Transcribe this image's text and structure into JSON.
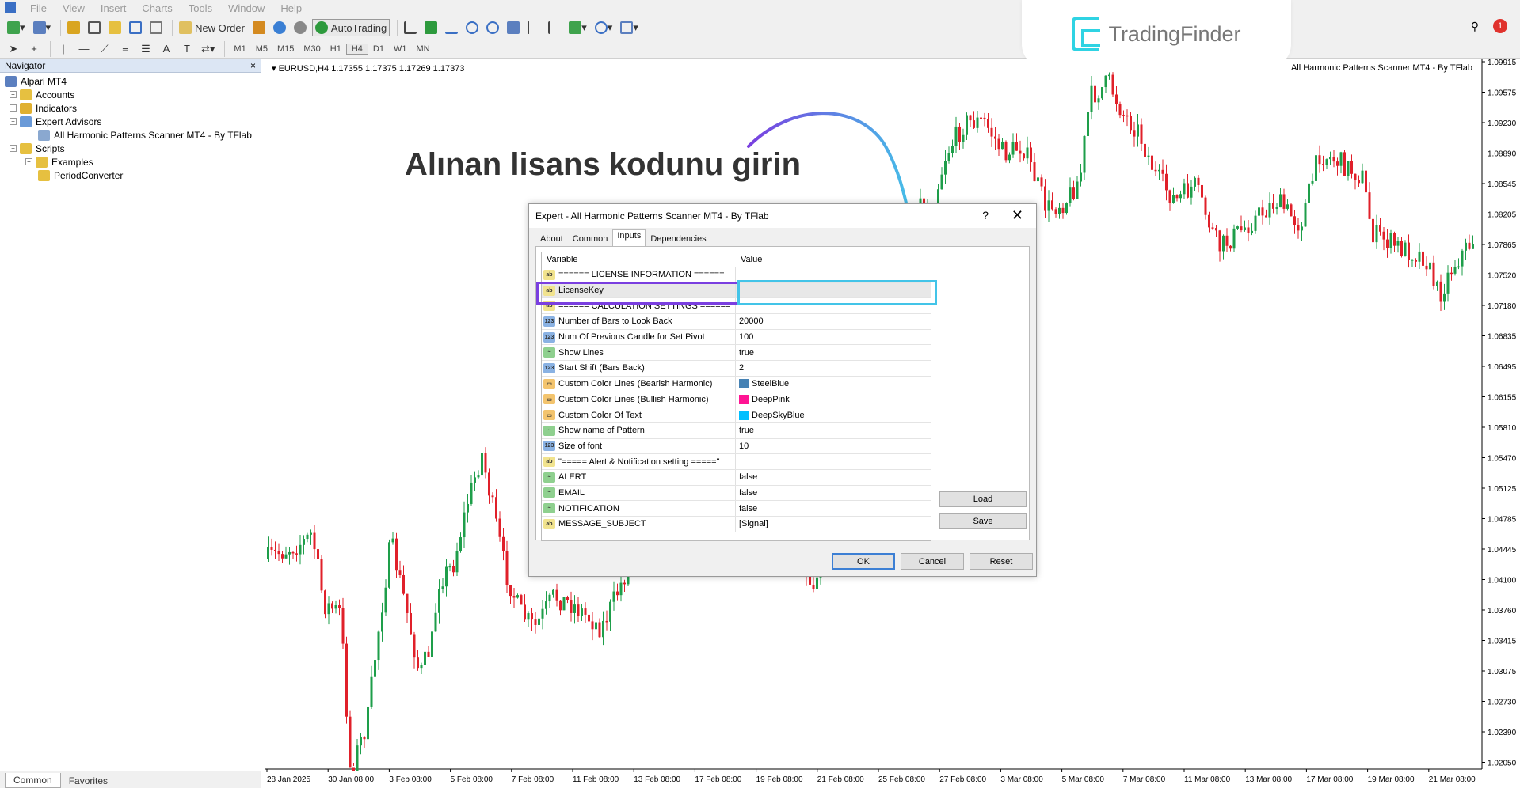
{
  "menu": [
    "File",
    "View",
    "Insert",
    "Charts",
    "Tools",
    "Window",
    "Help"
  ],
  "toolbar": {
    "new_order": "New Order",
    "autotrading": "AutoTrading",
    "timeframes": [
      "M1",
      "M5",
      "M15",
      "M30",
      "H1",
      "H4",
      "D1",
      "W1",
      "MN"
    ]
  },
  "brand": {
    "name": "TradingFinder"
  },
  "notification_count": "1",
  "navigator": {
    "title": "Navigator",
    "close": "×",
    "root": "Alpari MT4",
    "items": [
      {
        "label": "Accounts",
        "level": 1
      },
      {
        "label": "Indicators",
        "level": 1
      },
      {
        "label": "Expert Advisors",
        "level": 1
      },
      {
        "label": "All Harmonic Patterns Scanner MT4 - By TFlab",
        "level": 2
      },
      {
        "label": "Scripts",
        "level": 1
      },
      {
        "label": "Examples",
        "level": 2
      },
      {
        "label": "PeriodConverter",
        "level": 2
      }
    ],
    "tabs": {
      "common": "Common",
      "favorites": "Favorites"
    }
  },
  "chart": {
    "symbol_line": "EURUSD,H4  1.17355 1.17375 1.17269 1.17373",
    "indicator_label": "All Harmonic Patterns Scanner MT4 - By TFlab",
    "annotation": "Alınan lisans kodunu girin",
    "price_ticks": [
      "1.09915",
      "1.09575",
      "1.09230",
      "1.08890",
      "1.08545",
      "1.08205",
      "1.07865",
      "1.07520",
      "1.07180",
      "1.06835",
      "1.06495",
      "1.06155",
      "1.05810",
      "1.05470",
      "1.05125",
      "1.04785",
      "1.04445",
      "1.04100",
      "1.03760",
      "1.03415",
      "1.03075",
      "1.02730",
      "1.02390",
      "1.02050"
    ],
    "time_ticks": [
      "28 Jan 2025",
      "30 Jan 08:00",
      "3 Feb 08:00",
      "5 Feb 08:00",
      "7 Feb 08:00",
      "11 Feb 08:00",
      "13 Feb 08:00",
      "17 Feb 08:00",
      "19 Feb 08:00",
      "21 Feb 08:00",
      "25 Feb 08:00",
      "27 Feb 08:00",
      "3 Mar 08:00",
      "5 Mar 08:00",
      "7 Mar 08:00",
      "11 Mar 08:00",
      "13 Mar 08:00",
      "17 Mar 08:00",
      "19 Mar 08:00",
      "21 Mar 08:00"
    ],
    "colors": {
      "bull": "#1e9e4a",
      "bear": "#e0202a"
    }
  },
  "dialog": {
    "title": "Expert - All Harmonic Patterns Scanner MT4 - By TFlab",
    "help": "?",
    "close": "✕",
    "tabs": [
      "About",
      "Common",
      "Inputs",
      "Dependencies"
    ],
    "active_tab": "Inputs",
    "columns": {
      "variable": "Variable",
      "value": "Value"
    },
    "rows": [
      {
        "type": "ab",
        "name": "====== LICENSE INFORMATION ======",
        "value": ""
      },
      {
        "type": "ab",
        "name": "LicenseKey",
        "value": ""
      },
      {
        "type": "ab",
        "name": "====== CALCULATION SETTINGS ======",
        "value": ""
      },
      {
        "type": "n",
        "name": "Number of Bars to Look Back",
        "value": "20000"
      },
      {
        "type": "n",
        "name": "Num Of Previous Candle for Set Pivot",
        "value": "100"
      },
      {
        "type": "b",
        "name": "Show Lines",
        "value": "true"
      },
      {
        "type": "n",
        "name": "Start Shift (Bars Back)",
        "value": "2"
      },
      {
        "type": "c",
        "name": "Custom Color Lines (Bearish Harmonic)",
        "value": "SteelBlue",
        "swatch": "#4682b4"
      },
      {
        "type": "c",
        "name": "Custom Color Lines (Bullish Harmonic)",
        "value": "DeepPink",
        "swatch": "#ff1493"
      },
      {
        "type": "c",
        "name": "Custom Color Of Text",
        "value": "DeepSkyBlue",
        "swatch": "#00bfff"
      },
      {
        "type": "b",
        "name": "Show name of Pattern",
        "value": "true"
      },
      {
        "type": "n",
        "name": "Size of font",
        "value": "10"
      },
      {
        "type": "ab",
        "name": "\"===== Alert & Notification setting =====\"",
        "value": ""
      },
      {
        "type": "b",
        "name": "ALERT",
        "value": "false"
      },
      {
        "type": "b",
        "name": "EMAIL",
        "value": "false"
      },
      {
        "type": "b",
        "name": "NOTIFICATION",
        "value": "false"
      },
      {
        "type": "ab",
        "name": "MESSAGE_SUBJECT",
        "value": "[Signal]"
      }
    ],
    "buttons": {
      "load": "Load",
      "save": "Save",
      "ok": "OK",
      "cancel": "Cancel",
      "reset": "Reset"
    }
  },
  "highlight_colors": {
    "purple": "#7a3fe0",
    "cyan": "#43c4e8"
  }
}
